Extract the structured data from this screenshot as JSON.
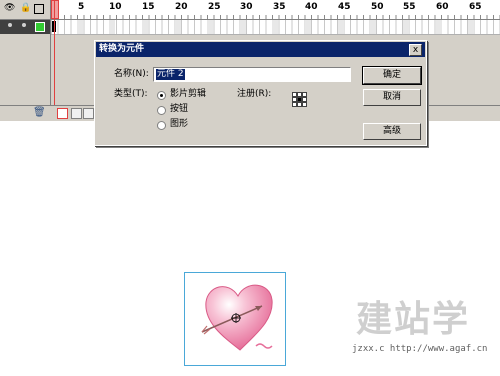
{
  "timeline": {
    "frame_numbers": [
      "1",
      "5",
      "10",
      "15",
      "20",
      "25",
      "30",
      "35",
      "40",
      "45",
      "50",
      "55",
      "60",
      "65"
    ]
  },
  "dialog": {
    "title": "转换为元件",
    "close_label": "x",
    "name_label": "名称(N):",
    "name_value": "元件 2",
    "type_label": "类型(T):",
    "type_options": [
      "影片剪辑",
      "按钮",
      "图形"
    ],
    "selected_type": "影片剪辑",
    "registration_label": "注册(R):",
    "ok_label": "确定",
    "cancel_label": "取消",
    "advanced_label": "高级"
  },
  "watermark": {
    "title": "建站学",
    "url": "jzxx.c   http://www.agaf.cn"
  },
  "colors": {
    "titlebar": "#0a246a",
    "playhead": "#e04040",
    "symbol_border": "#4aa8d8",
    "heart": "#f4a6c0"
  }
}
